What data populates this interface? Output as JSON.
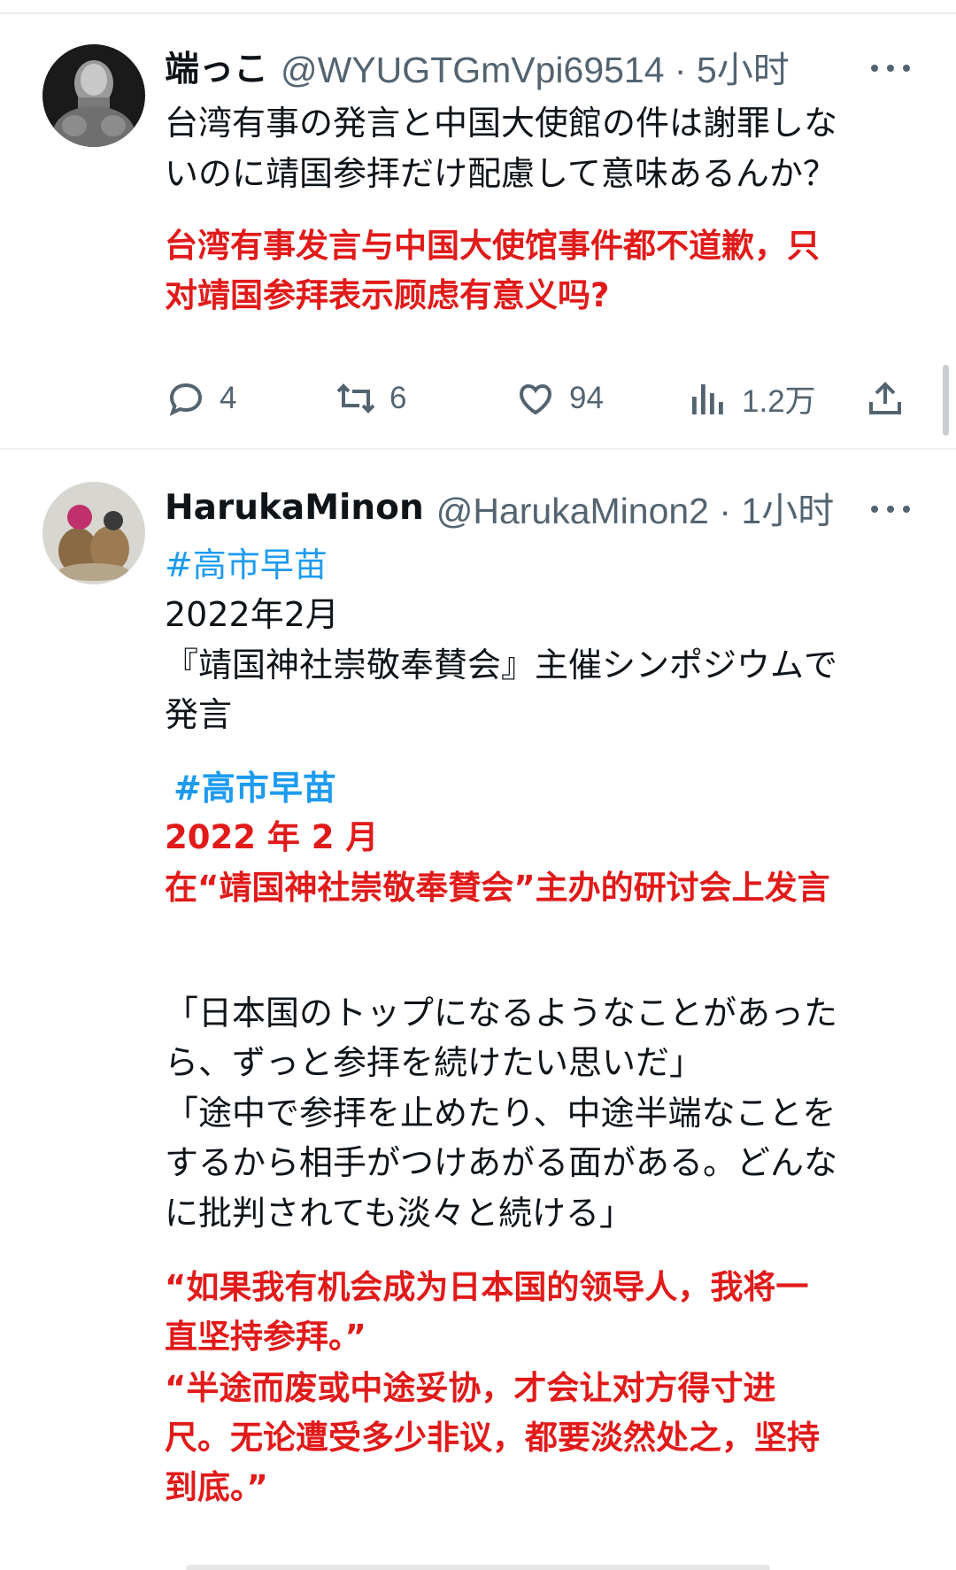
{
  "tweet1": {
    "name": "端っこ",
    "handle": "@WYUGTGmVpi69514 · 5小时",
    "lines": [
      "台湾有事の発言と中国大使館の件は謝罪しな",
      "いのに靖国参拝だけ配慮して意味あるんか？"
    ],
    "translation": [
      "台湾有事发言与中国大使馆事件都不道歉，只",
      "对靖国参拜表示顾虑有意义吗?"
    ],
    "actions": {
      "replies": "4",
      "retweets": "6",
      "likes": "94",
      "views": "1.2万"
    }
  },
  "tweet2": {
    "name": "HarukaMinon",
    "handle": "@HarukaMinon2 · 1小时",
    "hashtag": "#高市早苗",
    "date": "2022年2月",
    "event_lines": [
      "『靖国神社崇敬奉賛会』主催シンポジウムで",
      "発言"
    ],
    "translation_hashtag": "#高市早苗",
    "translation_date": "2022 年 2 月",
    "translation_event": "在“靖国神社崇敬奉賛会”主办的研讨会上发言",
    "quote_lines": [
      "「日本国のトップになるようなことがあった",
      "ら、ずっと参拝を続けたい思いだ」",
      "「途中で参拝を止めたり、中途半端なことを",
      "するから相手がつけあがる面がある。どんな",
      "に批判されても淡々と続ける」"
    ],
    "quote_translation": [
      "“如果我有机会成为日本国的领导人，我将一",
      "直坚持参拜。”",
      "“半途而废或中途妥协，才会让对方得寸进",
      "尺。无论遭受多少非议，都要淡然处之，坚持",
      "到底。”"
    ]
  }
}
